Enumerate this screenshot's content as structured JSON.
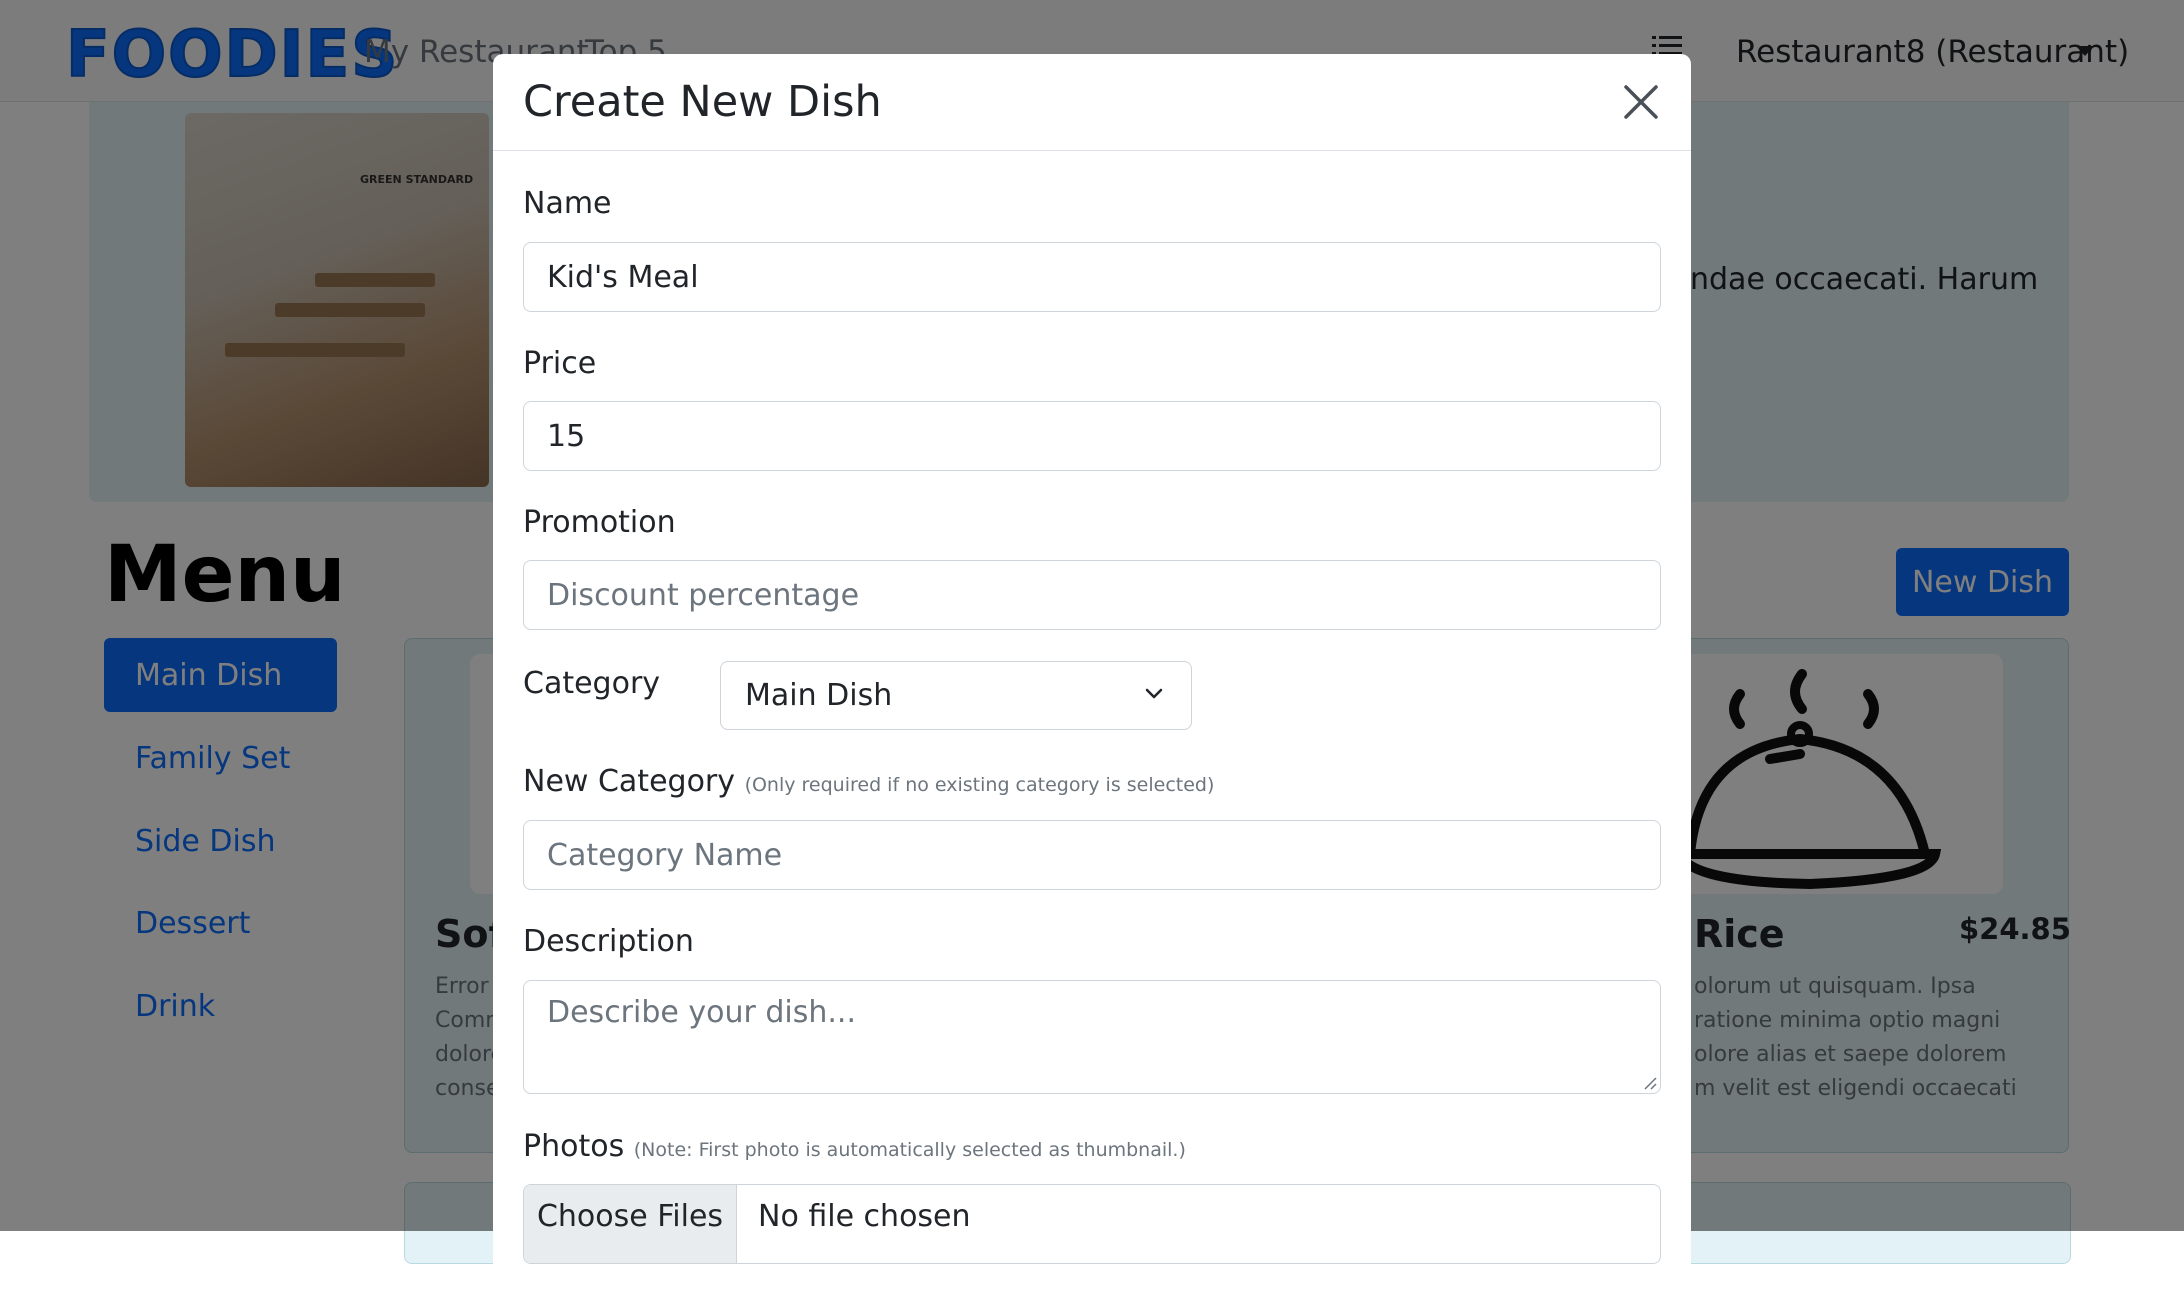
{
  "navbar": {
    "logo": "FOODIES",
    "links": [
      "My Restaurant",
      "Top 5"
    ],
    "user": "Restaurant8 (Restaurant)"
  },
  "hero": {
    "sign_text": "GREEN STANDARD",
    "description": "ndae occaecati. Harum"
  },
  "menu": {
    "title": "Menu",
    "new_dish_label": "New Dish",
    "categories": [
      "Main Dish",
      "Family Set",
      "Side Dish",
      "Dessert",
      "Drink"
    ],
    "card_left": {
      "title": "Sof",
      "desc": [
        "Error",
        "Comn",
        "dolore",
        "conse"
      ]
    },
    "card_right": {
      "title": "Rice",
      "price": "$24.85",
      "desc": [
        "olorum ut quisquam. Ipsa",
        "ratione minima optio magni",
        "olore alias et saepe dolorem",
        "m velit est eligendi occaecati"
      ]
    }
  },
  "modal": {
    "title": "Create New Dish",
    "name_label": "Name",
    "name_value": "Kid's Meal",
    "price_label": "Price",
    "price_value": "15",
    "promotion_label": "Promotion",
    "promotion_placeholder": "Discount percentage",
    "category_label": "Category",
    "category_selected": "Main Dish",
    "new_category_label": "New Category",
    "new_category_hint": "(Only required if no existing category is selected)",
    "new_category_placeholder": "Category Name",
    "description_label": "Description",
    "description_placeholder": "Describe your dish...",
    "photos_label": "Photos",
    "photos_hint": "(Note: First photo is automatically selected as thumbnail.)",
    "choose_files_label": "Choose Files",
    "file_status": "No file chosen"
  },
  "colors": {
    "primary": "#0d6efd",
    "hero_bg": "#e3f2f6",
    "backdrop": "rgba(0,0,0,0.5)"
  },
  "icons": {
    "close": "close-icon",
    "list": "list-icon",
    "caret": "caret-down-icon",
    "chevron": "chevron-down-icon"
  }
}
